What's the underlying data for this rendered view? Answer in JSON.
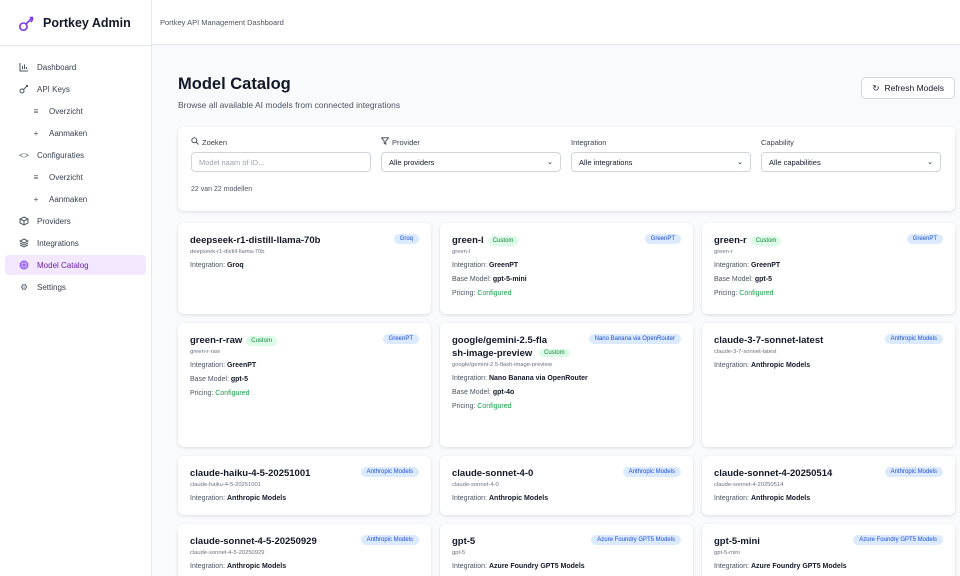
{
  "brand": {
    "title": "Portkey Admin"
  },
  "topbar": {
    "text": "Portkey API Management Dashboard"
  },
  "sidebar": {
    "items": [
      {
        "label": "Dashboard"
      },
      {
        "label": "API Keys"
      },
      {
        "label": "Overzicht"
      },
      {
        "label": "Aanmaken"
      },
      {
        "label": "Configuraties"
      },
      {
        "label": "Overzicht"
      },
      {
        "label": "Aanmaken"
      },
      {
        "label": "Providers"
      },
      {
        "label": "Integrations"
      },
      {
        "label": "Model Catalog"
      },
      {
        "label": "Settings"
      }
    ]
  },
  "page": {
    "title": "Model Catalog",
    "subtitle": "Browse all available AI models from connected integrations",
    "refresh_label": "Refresh Models"
  },
  "filters": {
    "search_label": "Zoeken",
    "search_placeholder": "Model naam of ID...",
    "provider_label": "Provider",
    "provider_value": "Alle providers",
    "integration_label": "Integration",
    "integration_value": "Alle integrations",
    "capability_label": "Capability",
    "capability_value": "Alle capabilities",
    "count": "22 van 22 modellen"
  },
  "labels": {
    "integration": "Integration:",
    "base_model": "Base Model:",
    "pricing": "Pricing:",
    "custom": "Custom"
  },
  "models": [
    {
      "name": "deepseek-r1-distill-llama-70b",
      "id": "deepseek-r1-distill-llama-70b",
      "integration": "Groq"
    },
    {
      "name": "green-l",
      "id": "green-l",
      "integration": "GreenPT",
      "base_model": "gpt-5-mini",
      "pricing": "Configured"
    },
    {
      "name": "green-r",
      "id": "green-r",
      "integration": "GreenPT",
      "base_model": "gpt-5",
      "pricing": "Configured"
    },
    {
      "name": "green-r-raw",
      "id": "green-r-raw",
      "integration": "GreenPT",
      "base_model": "gpt-5",
      "pricing": "Configured"
    },
    {
      "name": "google/gemini-2.5-flash-image-preview",
      "id": "google/gemini-2.5-flash-image-preview",
      "integration": "Nano Banana via OpenRouter",
      "base_model": "gpt-4o",
      "pricing": "Configured"
    },
    {
      "name": "claude-3-7-sonnet-latest",
      "id": "claude-3-7-sonnet-latest",
      "integration": "Anthropic Models"
    },
    {
      "name": "claude-haiku-4-5-20251001",
      "id": "claude-haiku-4-5-20251001",
      "integration": "Anthropic Models"
    },
    {
      "name": "claude-sonnet-4-0",
      "id": "claude-sonnet-4-0",
      "integration": "Anthropic Models"
    },
    {
      "name": "claude-sonnet-4-20250514",
      "id": "claude-sonnet-4-20250514",
      "integration": "Anthropic Models"
    },
    {
      "name": "claude-sonnet-4-5-20250929",
      "id": "claude-sonnet-4-5-20250929",
      "integration": "Anthropic Models"
    },
    {
      "name": "gpt-5",
      "id": "gpt-5",
      "integration": "Azure Foundry GPT5 Models"
    },
    {
      "name": "gpt-5-mini",
      "id": "gpt-5-mini",
      "integration": "Azure Foundry GPT5 Models"
    }
  ]
}
